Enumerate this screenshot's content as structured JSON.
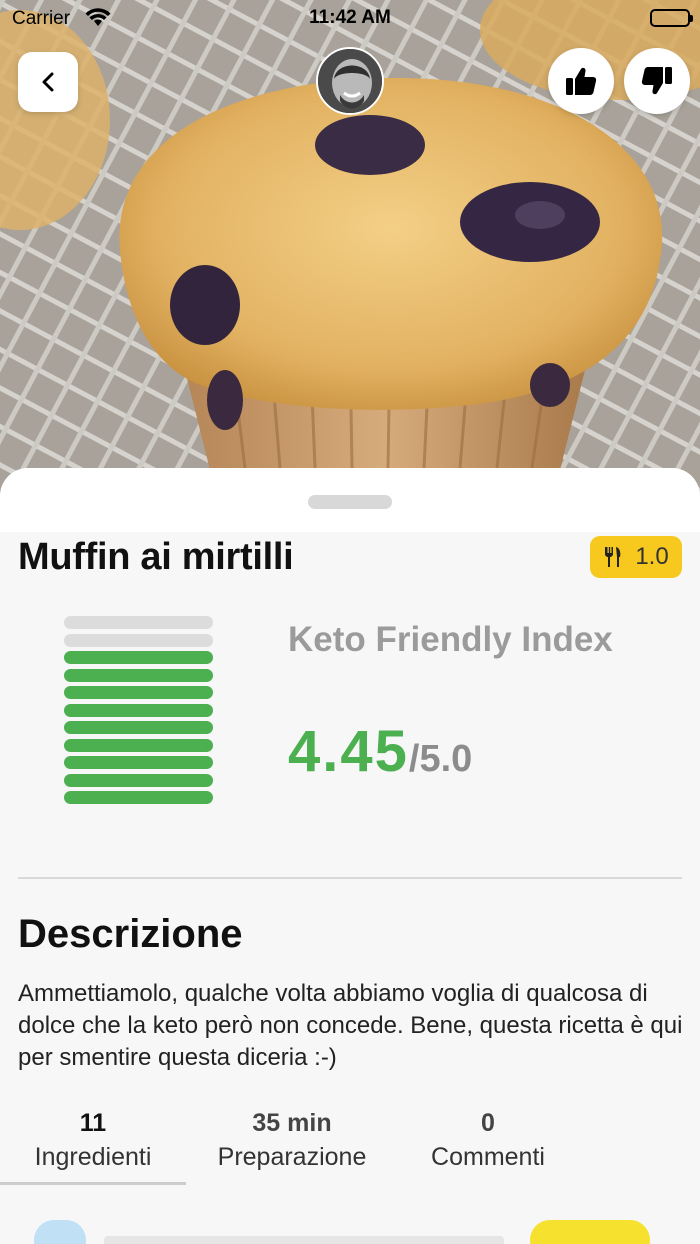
{
  "status_bar": {
    "carrier": "Carrier",
    "time": "11:42 AM"
  },
  "hero": {
    "back_icon": "chevron-left-icon",
    "like_icon": "thumbs-up-icon",
    "dislike_icon": "thumbs-down-icon"
  },
  "recipe": {
    "title": "Muffin ai mirtilli",
    "servings_icon": "fork-knife-icon",
    "servings": "1.0"
  },
  "keto_index": {
    "label": "Keto Friendly Index",
    "score": "4.45",
    "max": "/5.0",
    "filled_bars": 9,
    "total_bars": 11,
    "colors": {
      "filled": "#4caf50",
      "empty": "#dcdcdc"
    }
  },
  "description": {
    "heading": "Descrizione",
    "text": "Ammettiamolo, qualche volta abbiamo voglia di qualcosa di dolce che la keto però non concede. Bene, questa ricetta è qui per smentire questa diceria :-)"
  },
  "tabs": [
    {
      "count": "11",
      "label": "Ingredienti"
    },
    {
      "count": "35 min",
      "label": "Preparazione"
    },
    {
      "count": "0",
      "label": "Commenti"
    }
  ],
  "colors": {
    "accent_yellow": "#f7c91f",
    "green": "#4caf50"
  }
}
